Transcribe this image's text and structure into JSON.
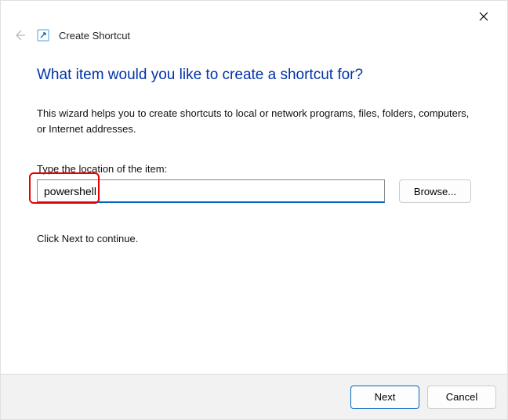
{
  "header": {
    "title": "Create Shortcut"
  },
  "wizard": {
    "heading": "What item would you like to create a shortcut for?",
    "description": "This wizard helps you to create shortcuts to local or network programs, files, folders, computers, or Internet addresses.",
    "location_label": "Type the location of the item:",
    "location_value": "powershell",
    "browse_label": "Browse...",
    "continue_text": "Click Next to continue."
  },
  "footer": {
    "next_label": "Next",
    "cancel_label": "Cancel"
  }
}
